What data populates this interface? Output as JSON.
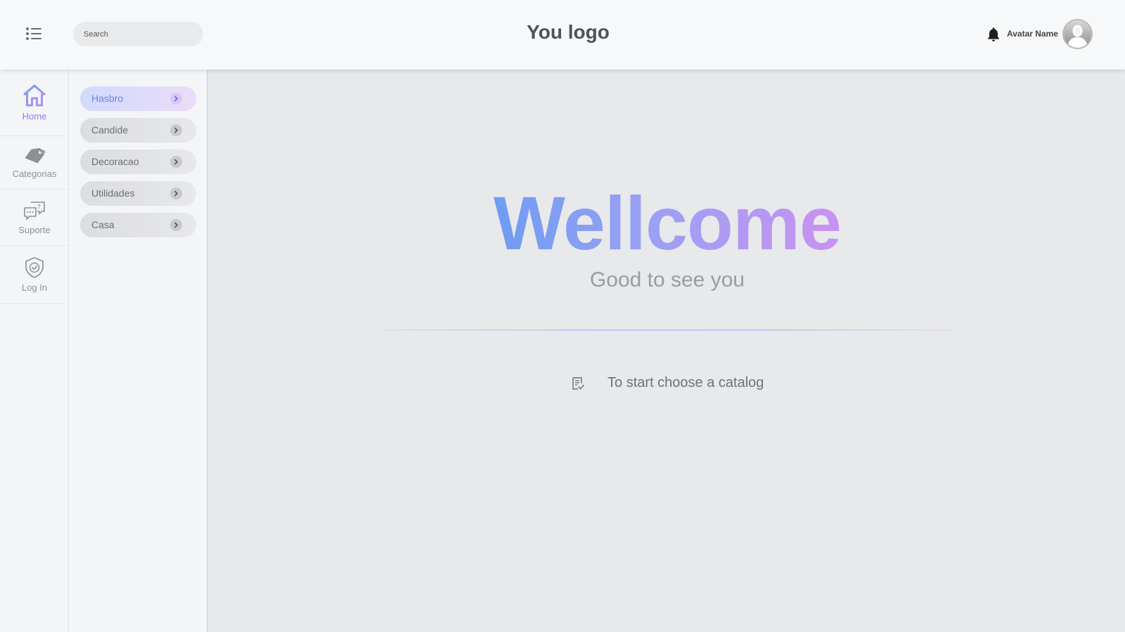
{
  "header": {
    "search_placeholder": "Search",
    "logo": "You logo",
    "avatar_name": "Avatar Name"
  },
  "rail": {
    "items": [
      {
        "label": "Home",
        "icon": "home-icon",
        "active": true
      },
      {
        "label": "Categorias",
        "icon": "tag-icon",
        "active": false
      },
      {
        "label": "Suporte",
        "icon": "support-chat-icon",
        "active": false
      },
      {
        "label": "Log In",
        "icon": "shield-check-icon",
        "active": false
      }
    ]
  },
  "catalogs": {
    "items": [
      {
        "label": "Hasbro",
        "active": true
      },
      {
        "label": "Candide",
        "active": false
      },
      {
        "label": "Decoracao",
        "active": false
      },
      {
        "label": "Utilidades",
        "active": false
      },
      {
        "label": "Casa",
        "active": false
      }
    ]
  },
  "main": {
    "title": "Wellcome",
    "subtitle": "Good to see you",
    "hint": "To start choose a catalog"
  },
  "colors": {
    "accent_blue": "#6f9cf2",
    "accent_purple": "#c992f2",
    "active_rail": "#8f7cf0"
  }
}
